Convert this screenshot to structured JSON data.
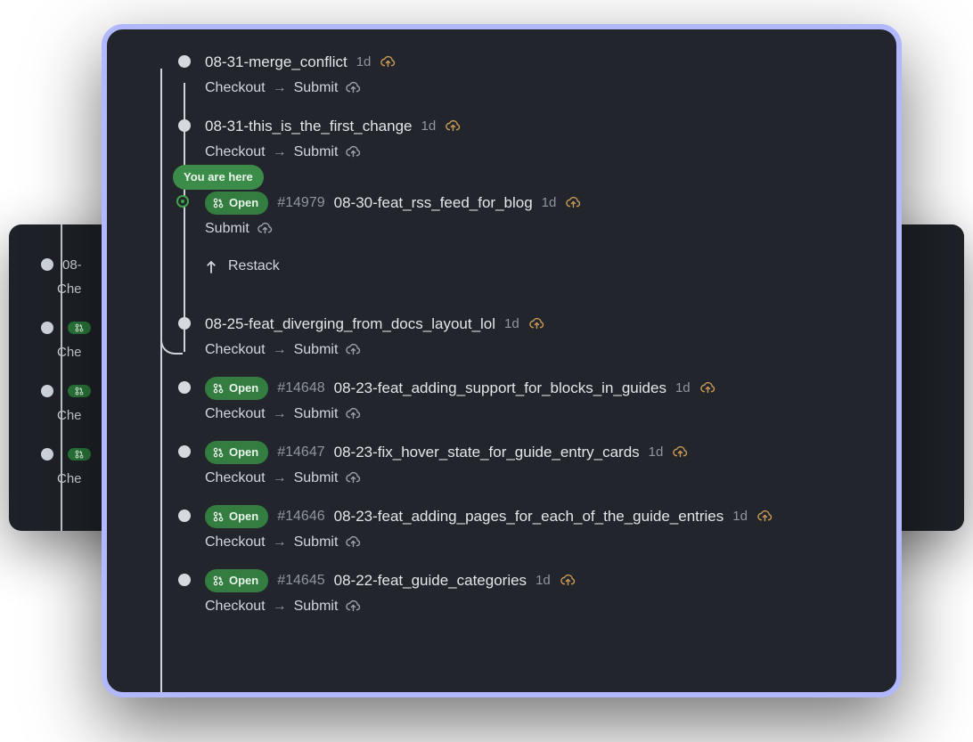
{
  "labels": {
    "checkout": "Checkout",
    "submit": "Submit",
    "restack": "Restack",
    "open": "Open",
    "you_are_here": "You are here"
  },
  "ghost": {
    "items": [
      {
        "branch_prefix": "08-",
        "sub_prefix": "Che",
        "has_pill": false
      },
      {
        "branch_prefix": "",
        "sub_prefix": "Che",
        "has_pill": true
      },
      {
        "branch_prefix": "",
        "sub_prefix": "Che",
        "has_pill": true
      },
      {
        "branch_prefix": "",
        "sub_prefix": "Che",
        "has_pill": true
      }
    ]
  },
  "entries": [
    {
      "id": "e0",
      "branch": "08-31-merge_conflict",
      "age": "1d",
      "pr": null,
      "open": false,
      "cloud": "amber",
      "actions": [
        "checkout",
        "submit"
      ],
      "here": false
    },
    {
      "id": "e1",
      "branch": "08-31-this_is_the_first_change",
      "age": "1d",
      "pr": null,
      "open": false,
      "cloud": "amber",
      "actions": [
        "checkout",
        "submit"
      ],
      "here": false
    },
    {
      "id": "e2",
      "branch": "08-30-feat_rss_feed_for_blog",
      "age": "1d",
      "pr": "#14979",
      "open": true,
      "cloud": "amber",
      "actions": [
        "submit"
      ],
      "here": true
    },
    {
      "id": "e3",
      "branch": "08-25-feat_diverging_from_docs_layout_lol",
      "age": "1d",
      "pr": null,
      "open": false,
      "cloud": "amber",
      "actions": [
        "checkout",
        "submit"
      ],
      "here": false
    },
    {
      "id": "e4",
      "branch": "08-23-feat_adding_support_for_blocks_in_guides",
      "age": "1d",
      "pr": "#14648",
      "open": true,
      "cloud": "amber",
      "actions": [
        "checkout",
        "submit"
      ],
      "here": false
    },
    {
      "id": "e5",
      "branch": "08-23-fix_hover_state_for_guide_entry_cards",
      "age": "1d",
      "pr": "#14647",
      "open": true,
      "cloud": "amber",
      "actions": [
        "checkout",
        "submit"
      ],
      "here": false
    },
    {
      "id": "e6",
      "branch": "08-23-feat_adding_pages_for_each_of_the_guide_entries",
      "age": "1d",
      "pr": "#14646",
      "open": true,
      "cloud": "amber",
      "actions": [
        "checkout",
        "submit"
      ],
      "here": false
    },
    {
      "id": "e7",
      "branch": "08-22-feat_guide_categories",
      "age": "1d",
      "pr": "#14645",
      "open": true,
      "cloud": "amber",
      "actions": [
        "checkout",
        "submit"
      ],
      "here": false
    }
  ]
}
